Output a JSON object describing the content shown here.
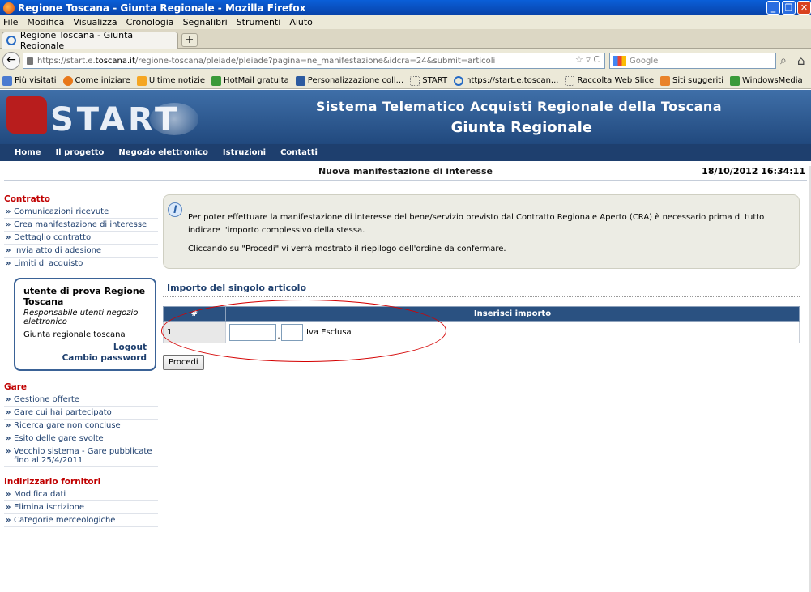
{
  "browser": {
    "window_title": "Regione Toscana - Giunta Regionale - Mozilla Firefox",
    "menu": [
      "File",
      "Modifica",
      "Visualizza",
      "Cronologia",
      "Segnalibri",
      "Strumenti",
      "Aiuto"
    ],
    "tab_title": "Regione Toscana - Giunta Regionale",
    "url_prefix": "https://start.e.",
    "url_domain": "toscana.it",
    "url_rest": "/regione-toscana/pleiade/pleiade?pagina=ne_manifestazione&idcra=24&submit=articoli",
    "search_placeholder": "Google",
    "bookmarks": [
      "Più visitati",
      "Come iniziare",
      "Ultime notizie",
      "HotMail gratuita",
      "Personalizzazione coll...",
      "START",
      "https://start.e.toscan...",
      "Raccolta Web Slice",
      "Siti suggeriti",
      "WindowsMedia"
    ]
  },
  "header": {
    "logo": "START",
    "line1": "Sistema Telematico Acquisti Regionale della Toscana",
    "line2": "Giunta Regionale",
    "nav": [
      "Home",
      "Il progetto",
      "Negozio elettronico",
      "Istruzioni",
      "Contatti"
    ]
  },
  "pagebar": {
    "title": "Nuova manifestazione di interesse",
    "datetime": "18/10/2012 16:34:11"
  },
  "sidebar": {
    "contratto_title": "Contratto",
    "contratto_items": [
      "Comunicazioni ricevute",
      "Crea manifestazione di interesse",
      "Dettaglio contratto",
      "Invia atto di adesione",
      "Limiti di acquisto"
    ],
    "user": {
      "name": "utente di prova Regione Toscana",
      "role": "Responsabile utenti negozio elettronico",
      "org": "Giunta regionale toscana",
      "logout": "Logout",
      "change_password": "Cambio password"
    },
    "gare_title": "Gare",
    "gare_items": [
      "Gestione offerte",
      "Gare cui hai partecipato",
      "Ricerca gare non concluse",
      "Esito delle gare svolte",
      "Vecchio sistema - Gare pubblicate fino al 25/4/2011"
    ],
    "fornitori_title": "Indirizzario fornitori",
    "fornitori_items": [
      "Modifica dati",
      "Elimina iscrizione",
      "Categorie merceologiche"
    ]
  },
  "main": {
    "info_p1": "Per poter effettuare la manifestazione di interesse del bene/servizio previsto dal Contratto Regionale Aperto (CRA) è necessario prima di tutto indicare l'importo complessivo della stessa.",
    "info_p2": "Cliccando su \"Procedi\" vi verrà mostrato il riepilogo dell'ordine da confermare.",
    "section_title": "Importo del singolo articolo",
    "table": {
      "col_num": "#",
      "col_amount": "Inserisci importo",
      "row_num": "1",
      "comma": ",",
      "iva_label": "Iva Esclusa"
    },
    "procedi_button": "Procedi"
  }
}
